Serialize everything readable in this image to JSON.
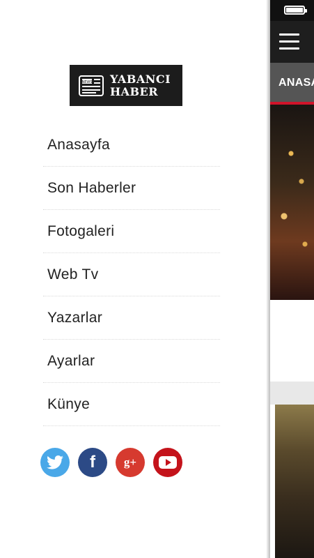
{
  "logo": {
    "line1": "YABANCI",
    "line2": "HABER",
    "icon_text": "NEWS"
  },
  "menu": {
    "items": [
      {
        "label": "Anasayfa"
      },
      {
        "label": "Son Haberler"
      },
      {
        "label": "Fotogaleri"
      },
      {
        "label": "Web Tv"
      },
      {
        "label": "Yazarlar"
      },
      {
        "label": "Ayarlar"
      },
      {
        "label": "Künye"
      }
    ]
  },
  "social": {
    "twitter": {
      "icon": "twitter-icon",
      "color": "#4aa8e8"
    },
    "facebook": {
      "icon": "facebook-icon",
      "color": "#2c4a86",
      "glyph": "f"
    },
    "googleplus": {
      "icon": "google-plus-icon",
      "color": "#d63a2f",
      "glyph": "g+"
    },
    "youtube": {
      "icon": "youtube-icon",
      "color": "#c4131b"
    }
  },
  "main": {
    "tab_label": "ANASAYFA",
    "accent_color": "#d0142a"
  }
}
